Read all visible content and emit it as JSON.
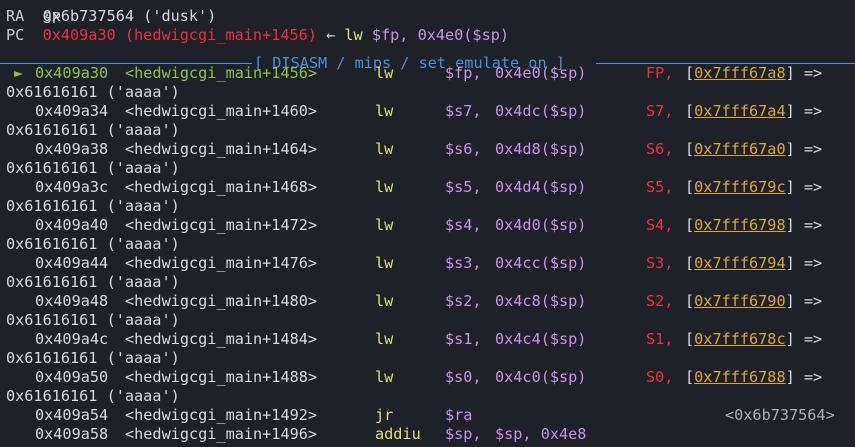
{
  "registers": {
    "sp_partial": "SP",
    "ra_label": "RA",
    "ra_value": "0x6b737564 ('dusk')",
    "pc_label": "PC",
    "pc_value": "0x409a30 (hedwigcgi_main+1456)",
    "pc_arrow": "←",
    "pc_instr": "lw",
    "pc_ops_reg": "$fp,",
    "pc_ops_rest": "0x4e0($sp)"
  },
  "banner": {
    "text": "[ DISASM / mips / set emulate on ]"
  },
  "disasm": [
    {
      "marker": "►",
      "addr": "0x409a30",
      "sym": "<hedwigcgi_main+1456>",
      "mn": "lw",
      "op1": "$fp,",
      "op2": "0x4e0($sp)",
      "reg": "FP,",
      "ptr": "0x7fff67a8",
      "arrow": "=>",
      "val": "0x61616161 ('aaaa')",
      "current": true
    },
    {
      "marker": "",
      "addr": "0x409a34",
      "sym": "<hedwigcgi_main+1460>",
      "mn": "lw",
      "op1": "$s7,",
      "op2": "0x4dc($sp)",
      "reg": "S7,",
      "ptr": "0x7fff67a4",
      "arrow": "=>",
      "val": "0x61616161 ('aaaa')",
      "current": false
    },
    {
      "marker": "",
      "addr": "0x409a38",
      "sym": "<hedwigcgi_main+1464>",
      "mn": "lw",
      "op1": "$s6,",
      "op2": "0x4d8($sp)",
      "reg": "S6,",
      "ptr": "0x7fff67a0",
      "arrow": "=>",
      "val": "0x61616161 ('aaaa')",
      "current": false
    },
    {
      "marker": "",
      "addr": "0x409a3c",
      "sym": "<hedwigcgi_main+1468>",
      "mn": "lw",
      "op1": "$s5,",
      "op2": "0x4d4($sp)",
      "reg": "S5,",
      "ptr": "0x7fff679c",
      "arrow": "=>",
      "val": "0x61616161 ('aaaa')",
      "current": false
    },
    {
      "marker": "",
      "addr": "0x409a40",
      "sym": "<hedwigcgi_main+1472>",
      "mn": "lw",
      "op1": "$s4,",
      "op2": "0x4d0($sp)",
      "reg": "S4,",
      "ptr": "0x7fff6798",
      "arrow": "=>",
      "val": "0x61616161 ('aaaa')",
      "current": false
    },
    {
      "marker": "",
      "addr": "0x409a44",
      "sym": "<hedwigcgi_main+1476>",
      "mn": "lw",
      "op1": "$s3,",
      "op2": "0x4cc($sp)",
      "reg": "S3,",
      "ptr": "0x7fff6794",
      "arrow": "=>",
      "val": "0x61616161 ('aaaa')",
      "current": false
    },
    {
      "marker": "",
      "addr": "0x409a48",
      "sym": "<hedwigcgi_main+1480>",
      "mn": "lw",
      "op1": "$s2,",
      "op2": "0x4c8($sp)",
      "reg": "S2,",
      "ptr": "0x7fff6790",
      "arrow": "=>",
      "val": "0x61616161 ('aaaa')",
      "current": false
    },
    {
      "marker": "",
      "addr": "0x409a4c",
      "sym": "<hedwigcgi_main+1484>",
      "mn": "lw",
      "op1": "$s1,",
      "op2": "0x4c4($sp)",
      "reg": "S1,",
      "ptr": "0x7fff678c",
      "arrow": "=>",
      "val": "0x61616161 ('aaaa')",
      "current": false
    },
    {
      "marker": "",
      "addr": "0x409a50",
      "sym": "<hedwigcgi_main+1488>",
      "mn": "lw",
      "op1": "$s0,",
      "op2": "0x4c0($sp)",
      "reg": "S0,",
      "ptr": "0x7fff6788",
      "arrow": "=>",
      "val": "0x61616161 ('aaaa')",
      "current": false
    }
  ],
  "tail": [
    {
      "addr": "0x409a54",
      "sym": "<hedwigcgi_main+1492>",
      "mn": "jr",
      "op1": "$ra",
      "op2": "",
      "extra": "<0x6b737564>"
    },
    {
      "addr": "0x409a58",
      "sym": "<hedwigcgi_main+1496>",
      "mn": "addiu",
      "op1": "$sp,",
      "op2": "$sp, 0x4e8",
      "extra": ""
    }
  ],
  "colors": {
    "background": "#1e2127",
    "red": "#e8313e",
    "green": "#8bc34a",
    "yellow": "#e2df7a",
    "purple": "#c792ea",
    "banner": "#4f8fd6",
    "pointer": "#d8a93a"
  }
}
